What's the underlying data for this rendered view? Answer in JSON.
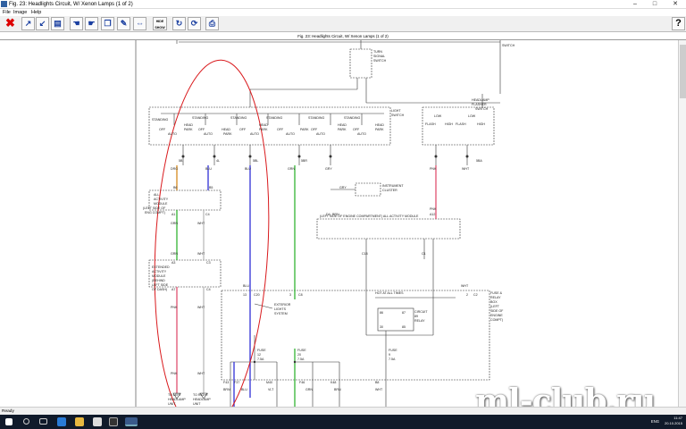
{
  "window": {
    "title": "Fig. 23: Headlights Circuit, W/ Xenon Lamps (1 of 2)",
    "minimize": "–",
    "maximize": "□",
    "close": "✕"
  },
  "menu": {
    "file": "File",
    "image": "Image",
    "help": "Help"
  },
  "toolbar": {
    "hide_line1": "HIDE",
    "hide_line2": "SHOW",
    "help_label": "?"
  },
  "document_title": "Fig. 23: Headlights Circuit, W/ Xenon Lamps (1 of 2)",
  "diagram": {
    "switch_label": "SWITCH",
    "turn_signal_switch": [
      "TURN",
      "SIGNAL",
      "SWITCH"
    ],
    "light_switch": [
      "LIGHT",
      "SWITCH"
    ],
    "headlamp_flasher_switch": [
      "HEADLAMP",
      "FLASHER",
      "SWITCH"
    ],
    "standing": "STANDING",
    "off": "OFF",
    "auto": "AUTO",
    "head": "HEAD",
    "park": "PARK",
    "low": "LOW",
    "flash": "FLASH",
    "high": "HIGH",
    "instrument_cluster": [
      "INSTRUMENT",
      "CLUSTER"
    ],
    "all_activity_module_left": [
      "ALL",
      "ACTIVITY",
      "MODULE",
      "(LEFT SIDE OF",
      "ENG COMPT)"
    ],
    "all_activity_module_bus": "(LEFT SIDE OF ENGINE COMPARTMENT) ALL ACTIVITY MODULE",
    "extended_activity_module": [
      "EXTENDED",
      "ACTIVITY",
      "MODULE",
      "(BEHIND",
      "LEFT SIDE",
      "OF DASH)"
    ],
    "hot_at_all_times": "HOT AT ALL TIMES",
    "circuit_89_relay": [
      "CIRCUIT",
      "89",
      "RELAY"
    ],
    "fuse_relay_box": [
      "FUSE &",
      "RELAY",
      "BOX",
      "(LEFT",
      "SIDE OF",
      "ENGINE",
      "COMPT)"
    ],
    "exterior_lights_system": [
      "EXTERIOR",
      "LIGHTS",
      "SYSTEM"
    ],
    "fuse_12": [
      "FUSE",
      "12",
      "7.5A"
    ],
    "fuse_20": [
      "FUSE",
      "20",
      "7.5A"
    ],
    "fuse_9": [
      "FUSE",
      "9",
      "7.5A"
    ],
    "to_left_headlamp": [
      "TO LEFT",
      "HEADLAMP",
      "UNIT",
      "(XENON)"
    ],
    "to_right_headlamp": [
      "TO RIGHT",
      "HEADLAMP",
      "UNIT",
      "(XENON)"
    ],
    "wire_drg": "DRG",
    "wire_blu": "BLU",
    "wire_grn": "GRN",
    "wire_gry": "GRY",
    "wire_pnk": "PNK",
    "wire_wht": "WHT",
    "wire_brn": "BRN",
    "wire_vlt": "VLT",
    "pin_5b": "5B",
    "pin_4l": "4L",
    "pin_5bl": "5BL",
    "pin_5br": "5BR",
    "pin_5ba": "5BA",
    "pin_b6": "B6",
    "pin_b5": "B5",
    "pin_a1": "A1",
    "pin_c4": "C4",
    "pin_a3": "A3",
    "pin_c3": "C3",
    "pin_a7": "A7",
    "pin_c20": "C20",
    "pin_c18": "C18",
    "pin_c1": "C1",
    "pin_c2": "C2",
    "pin_d4": "D4",
    "pin_a12": "A12",
    "pin_b8": "B8",
    "pin_13": "13",
    "pin_3": "3",
    "pin_2": "2",
    "pin_1": "1",
    "pin_30": "30",
    "pin_85": "85",
    "pin_86": "86",
    "pin_87": "87",
    "pin_f43": "F43",
    "pin_f37": "F37",
    "pin_f46": "F46",
    "pin_m40": "M40",
    "pin_f46b": "F46",
    "pin_k48": "K48",
    "pin_wht_c8": "C8"
  },
  "status": "Ready",
  "taskbar": {
    "lang": "ENG",
    "time": "11:47",
    "date": "20.10.2015"
  },
  "watermark": "ml-club.ru",
  "colors": {
    "annotation": "#d9191c",
    "wire_blue": "#2f2fd6",
    "wire_green": "#33b433",
    "wire_pink": "#e05070",
    "wire_orange": "#d58a1e",
    "wire_gray": "#9a9a9a",
    "line": "#333333"
  }
}
